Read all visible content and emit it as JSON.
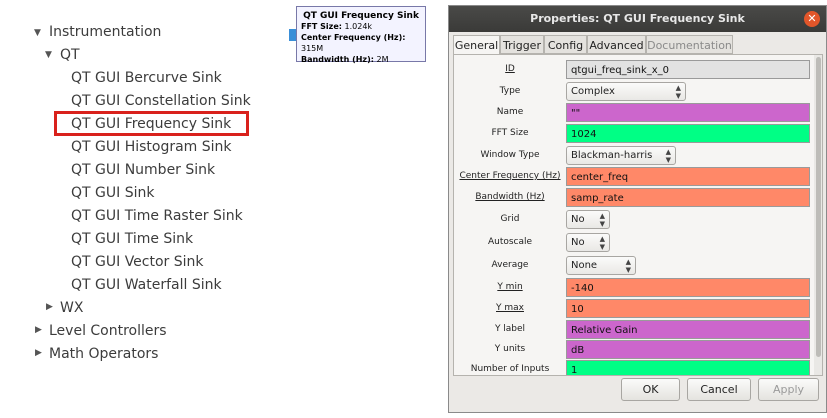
{
  "tree": {
    "instrumentation": "Instrumentation",
    "qt": "QT",
    "qt_items": [
      "QT GUI Bercurve Sink",
      "QT GUI Constellation Sink",
      "QT GUI Frequency Sink",
      "QT GUI Histogram Sink",
      "QT GUI Number Sink",
      "QT GUI Sink",
      "QT GUI Time Raster Sink",
      "QT GUI Time Sink",
      "QT GUI Vector Sink",
      "QT GUI Waterfall Sink"
    ],
    "wx": "WX",
    "level_controllers": "Level Controllers",
    "math_operators": "Math Operators"
  },
  "block": {
    "title": "QT GUI Frequency Sink",
    "fft_label": "FFT Size:",
    "fft_value": "1.024k",
    "cf_label": "Center Frequency (Hz):",
    "cf_value": "315M",
    "bw_label": "Bandwidth (Hz):",
    "bw_value": "2M"
  },
  "dialog": {
    "title": "Properties: QT GUI Frequency Sink",
    "tabs": [
      "General",
      "Trigger",
      "Config",
      "Advanced",
      "Documentation"
    ],
    "properties": [
      {
        "label": "ID",
        "value": "qtgui_freq_sink_x_0"
      },
      {
        "label": "Type",
        "value": "Complex"
      },
      {
        "label": "Name",
        "value": "\"\""
      },
      {
        "label": "FFT Size",
        "value": "1024"
      },
      {
        "label": "Window Type",
        "value": "Blackman-harris"
      },
      {
        "label": "Center Frequency (Hz)",
        "value": "center_freq"
      },
      {
        "label": "Bandwidth (Hz)",
        "value": "samp_rate"
      },
      {
        "label": "Grid",
        "value": "No"
      },
      {
        "label": "Autoscale",
        "value": "No"
      },
      {
        "label": "Average",
        "value": "None"
      },
      {
        "label": "Y min",
        "value": "-140"
      },
      {
        "label": "Y max",
        "value": "10"
      },
      {
        "label": "Y label",
        "value": "Relative Gain"
      },
      {
        "label": "Y units",
        "value": "dB"
      },
      {
        "label": "Number of Inputs",
        "value": "1"
      }
    ],
    "buttons": {
      "ok": "OK",
      "cancel": "Cancel",
      "apply": "Apply"
    }
  },
  "colors": {
    "highlight_border": "#d9211c",
    "field_green": "#00ff85",
    "field_orange": "#ff8868",
    "field_purple": "#cc66cc",
    "field_grey": "#e2e2e2",
    "titlebar": "#3c3b37"
  }
}
